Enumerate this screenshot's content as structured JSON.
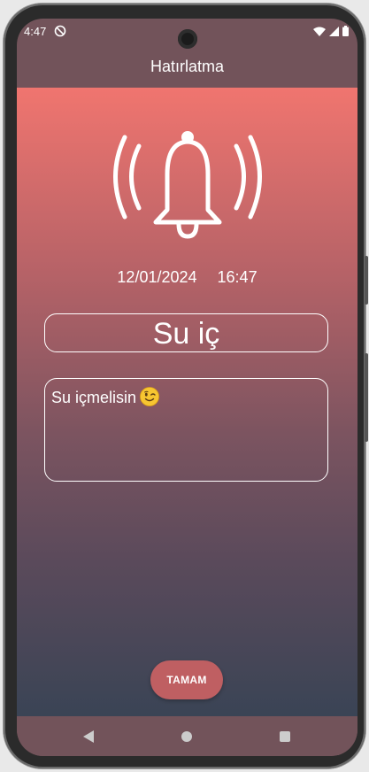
{
  "status_bar": {
    "time": "4:47",
    "icons": [
      "dnd-icon",
      "wifi-icon",
      "signal-icon",
      "battery-icon"
    ]
  },
  "app_bar": {
    "title": "Hatırlatma"
  },
  "reminder": {
    "icon": "ringing-bell-icon",
    "date": "12/01/2024",
    "time": "16:47",
    "title": "Su iç",
    "message": "Su içmelisin",
    "message_emoji": "winking-face-emoji"
  },
  "actions": {
    "ok_label": "TAMAM"
  },
  "navigation_bar": {
    "icons": [
      "back-icon",
      "home-icon",
      "recents-icon"
    ]
  },
  "colors": {
    "gradient_top": "#f0756f",
    "gradient_bottom": "#3a4455",
    "bar_background": "#72535a",
    "button": "#bf5f62"
  }
}
